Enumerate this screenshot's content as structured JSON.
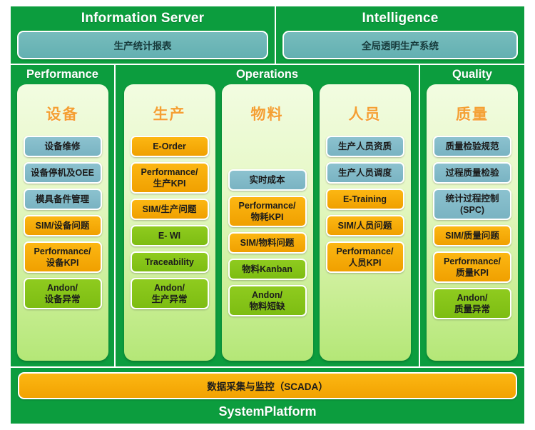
{
  "top": {
    "sections": [
      {
        "title": "Information Server",
        "box": "生产统计报表"
      },
      {
        "title": "Intelligence",
        "box": "全局透明生产系统"
      }
    ]
  },
  "bands": [
    {
      "title": "Performance",
      "panels": [
        {
          "title": "设备",
          "top_gap": false,
          "cards": [
            {
              "line1": "设备维修",
              "line2": "",
              "color": "blue"
            },
            {
              "line1": "设备停机及OEE",
              "line2": "",
              "color": "blue"
            },
            {
              "line1": "模具备件管理",
              "line2": "",
              "color": "blue"
            },
            {
              "line1": "SIM/设备问题",
              "line2": "",
              "color": "orange"
            },
            {
              "line1": "Performance/",
              "line2": "设备KPI",
              "color": "orange"
            },
            {
              "line1": "Andon/",
              "line2": "设备异常",
              "color": "green"
            }
          ]
        }
      ]
    },
    {
      "title": "Operations",
      "panels": [
        {
          "title": "生产",
          "top_gap": false,
          "cards": [
            {
              "line1": "E-Order",
              "line2": "",
              "color": "orange"
            },
            {
              "line1": "Performance/",
              "line2": "生产KPI",
              "color": "orange"
            },
            {
              "line1": "SIM/生产问题",
              "line2": "",
              "color": "orange"
            },
            {
              "line1": "E- WI",
              "line2": "",
              "color": "green"
            },
            {
              "line1": "Traceability",
              "line2": "",
              "color": "green"
            },
            {
              "line1": "Andon/",
              "line2": "生产异常",
              "color": "green"
            }
          ]
        },
        {
          "title": "物料",
          "top_gap": true,
          "cards": [
            {
              "line1": "实时成本",
              "line2": "",
              "color": "blue"
            },
            {
              "line1": "Performance/",
              "line2": "物耗KPI",
              "color": "orange"
            },
            {
              "line1": "SIM/物料问题",
              "line2": "",
              "color": "orange"
            },
            {
              "line1": "物料Kanban",
              "line2": "",
              "color": "green"
            },
            {
              "line1": "Andon/",
              "line2": "物料短缺",
              "color": "green"
            }
          ]
        },
        {
          "title": "人员",
          "top_gap": false,
          "cards": [
            {
              "line1": "生产人员资质",
              "line2": "",
              "color": "blue"
            },
            {
              "line1": "生产人员调度",
              "line2": "",
              "color": "blue"
            },
            {
              "line1": "E-Training",
              "line2": "",
              "color": "orange"
            },
            {
              "line1": "SIM/人员问题",
              "line2": "",
              "color": "orange"
            },
            {
              "line1": "Performance/",
              "line2": "人员KPI",
              "color": "orange"
            }
          ]
        }
      ]
    },
    {
      "title": "Quality",
      "panels": [
        {
          "title": "质量",
          "top_gap": false,
          "cards": [
            {
              "line1": "质量检验规范",
              "line2": "",
              "color": "blue"
            },
            {
              "line1": "过程质量检验",
              "line2": "",
              "color": "blue"
            },
            {
              "line1": "统计过程控制",
              "line2": "(SPC)",
              "color": "blue"
            },
            {
              "line1": "SIM/质量问题",
              "line2": "",
              "color": "orange"
            },
            {
              "line1": "Performance/",
              "line2": "质量KPI",
              "color": "orange"
            },
            {
              "line1": "Andon/",
              "line2": "质量异常",
              "color": "green"
            }
          ]
        }
      ]
    }
  ],
  "bottom": {
    "scada": "数据采集与监控（SCADA）",
    "platform": "SystemPlatform"
  },
  "colors": {
    "band_green": "#0c9d3e",
    "card_blue": "#79b3c2",
    "card_orange": "#f0a000",
    "card_green": "#7dbd12",
    "panel_title_orange": "#f4a033",
    "teal_box": "#63b0b1"
  }
}
